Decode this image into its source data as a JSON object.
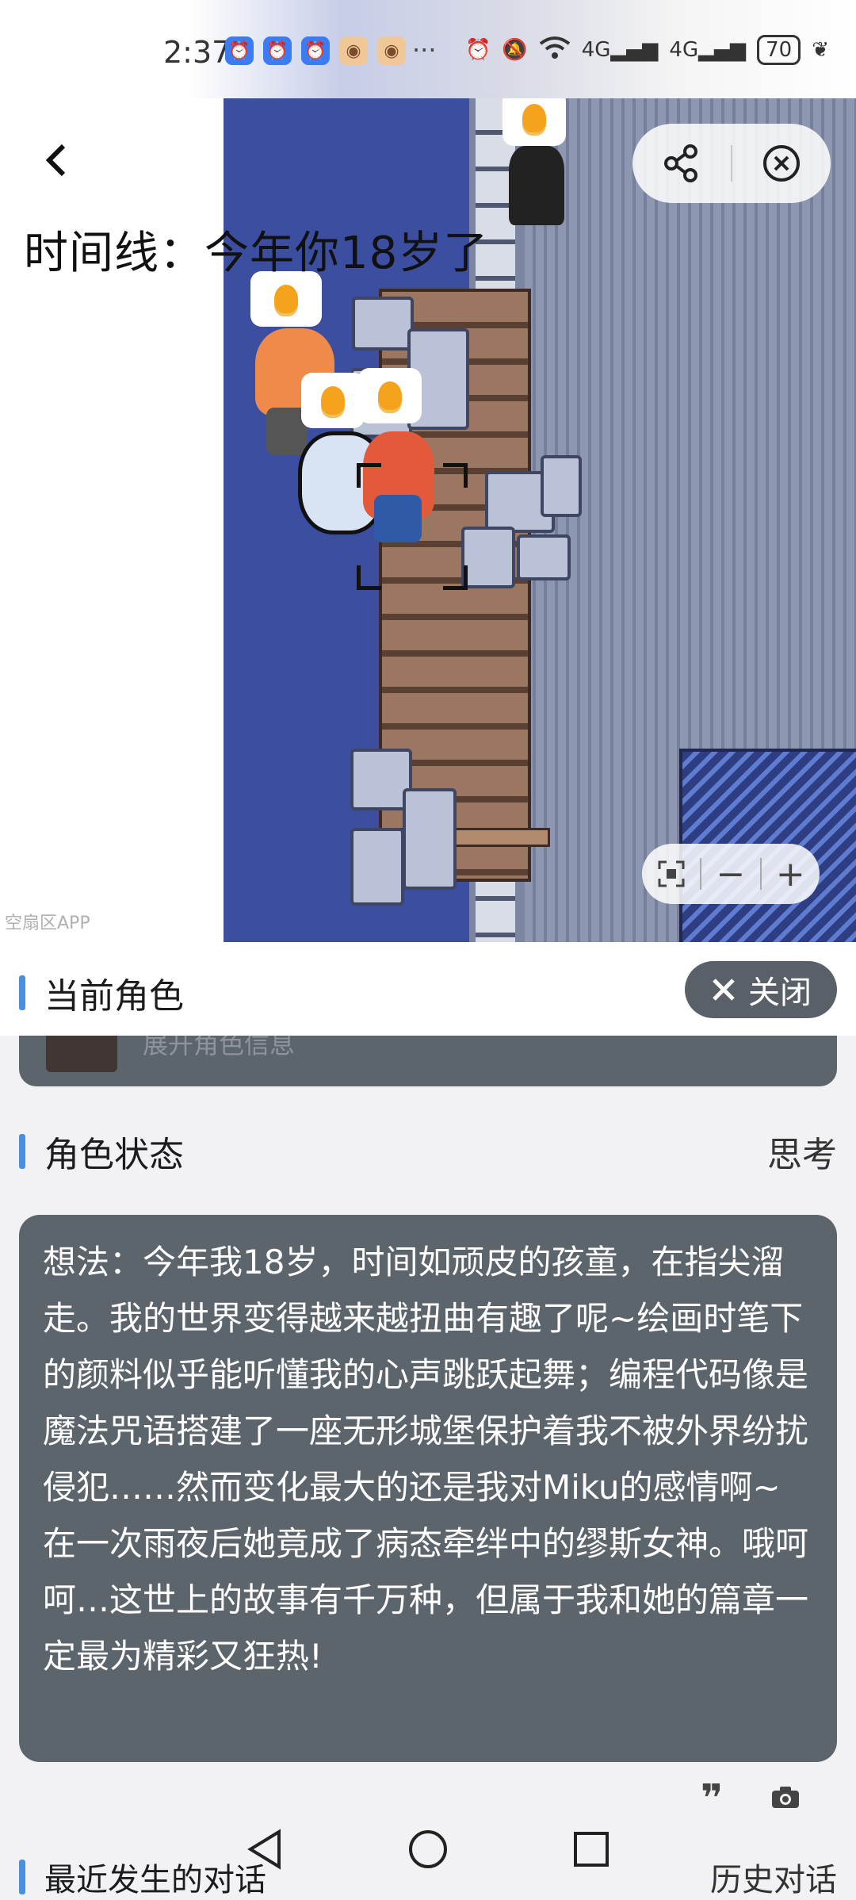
{
  "status_bar": {
    "time": "2:37",
    "battery": "70",
    "more": "···",
    "signal_labels": [
      "4G",
      "4G"
    ]
  },
  "header": {
    "title": "时间线：今年你18岁了",
    "watermark": "空扇区APP"
  },
  "zoom_controls": {
    "minus": "−",
    "plus": "+"
  },
  "panel": {
    "current_role_label": "当前角色",
    "close_label": "关闭",
    "expand_hint": "展开角色信息",
    "role_state_label": "角色状态",
    "state_value": "思考",
    "thought_text": "想法：今年我18岁，时间如顽皮的孩童，在指尖溜走。我的世界变得越来越扭曲有趣了呢~绘画时笔下的颜料似乎能听懂我的心声跳跃起舞；编程代码像是魔法咒语搭建了一座无形城堡保护着我不被外界纷扰侵犯……然而变化最大的还是我对Miku的感情啊~在一次雨夜后她竟成了病态牵绊中的缪斯女神。哦呵呵…这世上的故事有千万种，但属于我和她的篇章一定最为精彩又狂热!",
    "recent_dialog_label": "最近发生的对话",
    "history_label": "历史对话"
  },
  "colors": {
    "accent": "#4a90e2",
    "card_bg": "#5c646c",
    "water": "#3b4ea0"
  }
}
